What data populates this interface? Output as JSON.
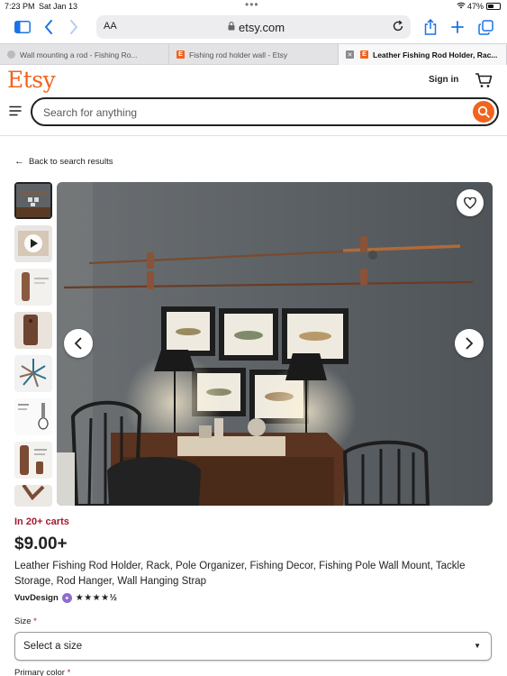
{
  "status_bar": {
    "time": "7:23 PM",
    "date": "Sat Jan 13",
    "battery": "47%",
    "battery_level": 0.47
  },
  "browser": {
    "aa_label": "AA",
    "url_host": "etsy.com",
    "tabs": [
      {
        "label": "Wall mounting a rod - Fishing Ro...",
        "favicon": "duckduckgo-icon"
      },
      {
        "label": "Fishing rod holder wall - Etsy",
        "favicon": "etsy-icon"
      },
      {
        "label": "Leather Fishing Rod Holder, Rac...",
        "favicon": "etsy-icon",
        "active": true
      }
    ]
  },
  "header": {
    "logo": "Etsy",
    "sign_in": "Sign in",
    "search_placeholder": "Search for anything"
  },
  "breadcrumb": {
    "back": "Back to search results"
  },
  "product": {
    "in_carts": "In 20+ carts",
    "price": "$9.00+",
    "title": "Leather Fishing Rod Holder, Rack, Pole Organizer, Fishing Decor, Fishing Pole Wall Mount, Tackle Storage, Rod Hanger, Wall Hanging Strap",
    "seller": "VuvDesign",
    "rating": 4.5,
    "stars": "★★★★½"
  },
  "options": {
    "size_label": "Size",
    "size_required": "*",
    "size_value": "Select a size",
    "color_label": "Primary color",
    "color_required": "*"
  },
  "colors": {
    "accent": "#f1641e",
    "sale_red": "#a61a2e",
    "ios_blue": "#1a73e8"
  }
}
